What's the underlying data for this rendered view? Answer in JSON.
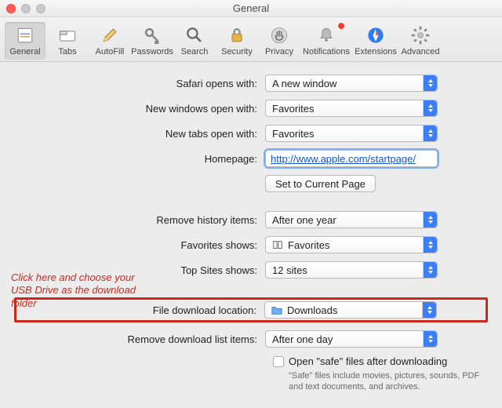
{
  "window": {
    "title": "General"
  },
  "toolbar": {
    "items": [
      {
        "label": "General"
      },
      {
        "label": "Tabs"
      },
      {
        "label": "AutoFill"
      },
      {
        "label": "Passwords"
      },
      {
        "label": "Search"
      },
      {
        "label": "Security"
      },
      {
        "label": "Privacy"
      },
      {
        "label": "Notifications"
      },
      {
        "label": "Extensions"
      },
      {
        "label": "Advanced"
      }
    ]
  },
  "form": {
    "opens_with": {
      "label": "Safari opens with:",
      "value": "A new window"
    },
    "new_windows": {
      "label": "New windows open with:",
      "value": "Favorites"
    },
    "new_tabs": {
      "label": "New tabs open with:",
      "value": "Favorites"
    },
    "homepage": {
      "label": "Homepage:",
      "value": "http://www.apple.com/startpage/"
    },
    "set_current": {
      "label": "Set to Current Page"
    },
    "remove_history": {
      "label": "Remove history items:",
      "value": "After one year"
    },
    "favorites_shows": {
      "label": "Favorites shows:",
      "value": "Favorites"
    },
    "top_sites": {
      "label": "Top Sites shows:",
      "value": "12 sites"
    },
    "download_location": {
      "label": "File download location:",
      "value": "Downloads"
    },
    "remove_downloads": {
      "label": "Remove download list items:",
      "value": "After one day"
    },
    "open_safe": {
      "label": "Open \"safe\" files after downloading",
      "help": "\"Safe\" files include movies, pictures, sounds, PDF and text documents, and archives."
    }
  },
  "annotation": {
    "text": "Click here and choose your USB Drive as the download folder"
  }
}
